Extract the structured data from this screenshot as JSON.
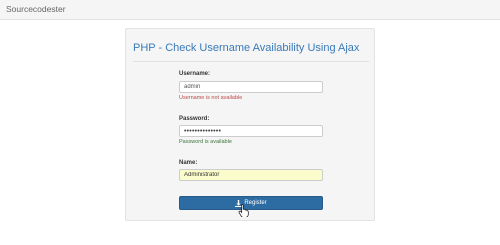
{
  "navbar": {
    "brand": "Sourcecodester"
  },
  "panel": {
    "title": "PHP - Check Username Availability Using Ajax"
  },
  "form": {
    "username": {
      "label": "Username:",
      "value": "admin",
      "message": "Username is not available",
      "message_status": "error"
    },
    "password": {
      "label": "Password:",
      "value": "••••••••••••••",
      "message": "Password is available",
      "message_status": "success"
    },
    "name": {
      "label": "Name:",
      "value": "Administrator"
    },
    "register_button": {
      "label": "Register",
      "icon": "download-icon"
    }
  },
  "colors": {
    "title": "#3a7ab9",
    "error": "#b94a48",
    "success": "#3c763d",
    "button": "#2d6ca2",
    "autofill": "#fbfccb"
  }
}
